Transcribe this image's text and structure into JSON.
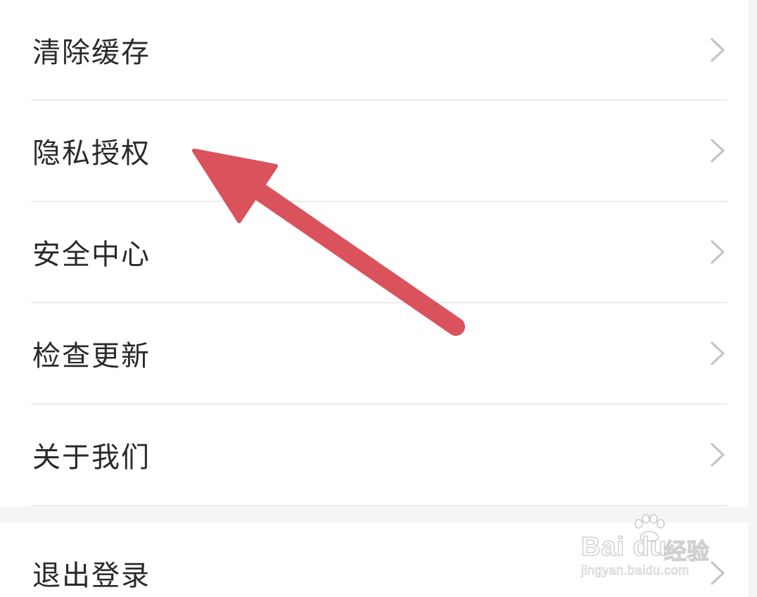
{
  "menu": {
    "items": [
      {
        "label": "清除缓存",
        "icon": "chevron-right-icon"
      },
      {
        "label": "隐私授权",
        "icon": "chevron-right-icon"
      },
      {
        "label": "安全中心",
        "icon": "chevron-right-icon"
      },
      {
        "label": "检查更新",
        "icon": "chevron-right-icon"
      },
      {
        "label": "关于我们",
        "icon": "chevron-right-icon"
      }
    ],
    "logout": {
      "label": "退出登录",
      "icon": "chevron-right-icon"
    }
  },
  "annotation": {
    "type": "arrow",
    "points_to": "隐私授权",
    "color": "#d9525c"
  },
  "watermark": {
    "brand": "Bai du",
    "product": "经验",
    "url": "jingyan.baidu.com"
  },
  "colors": {
    "text": "#2a2a2a",
    "divider": "#ebebeb",
    "chevron": "#c4c4c4",
    "background": "#ffffff",
    "gap": "#f5f5f5"
  }
}
